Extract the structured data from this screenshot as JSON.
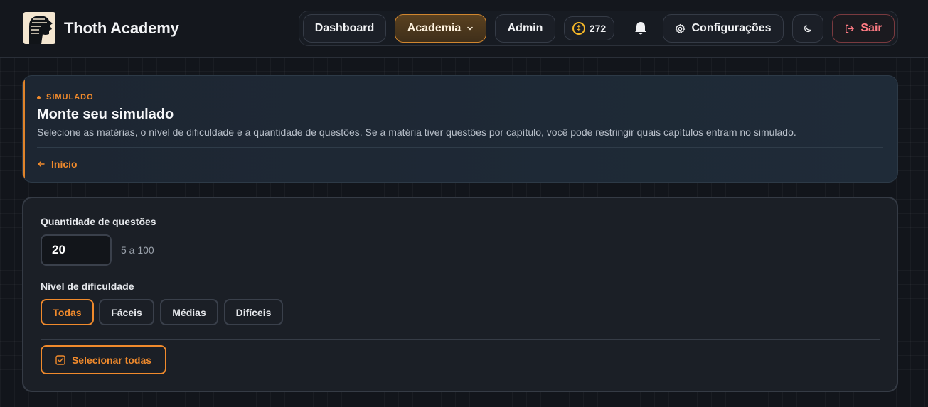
{
  "brand": {
    "name": "Thoth Academy",
    "logo_icon": "thoth-head-icon"
  },
  "nav": {
    "dashboard": "Dashboard",
    "academia": "Academia",
    "admin": "Admin",
    "coins": "272",
    "settings": "Configurações",
    "logout": "Sair"
  },
  "hero": {
    "eyebrow": "SIMULADO",
    "title": "Monte seu simulado",
    "description": "Selecione as matérias, o nível de dificuldade e a quantidade de questões. Se a matéria tiver questões por capítulo, você pode restringir quais capítulos entram no simulado.",
    "back": "Início"
  },
  "form": {
    "quantity_label": "Quantidade de questões",
    "quantity_value": "20",
    "quantity_hint": "5 a 100",
    "difficulty_label": "Nível de dificuldade",
    "difficulties": [
      "Todas",
      "Fáceis",
      "Médias",
      "Difíceis"
    ],
    "selected_difficulty": "Todas",
    "select_all": "Selecionar todas"
  },
  "colors": {
    "accent": "#f08a2c",
    "background": "#12151b",
    "panel": "#1b1f26",
    "logout": "#ff7b84",
    "coin": "#f6b829"
  }
}
